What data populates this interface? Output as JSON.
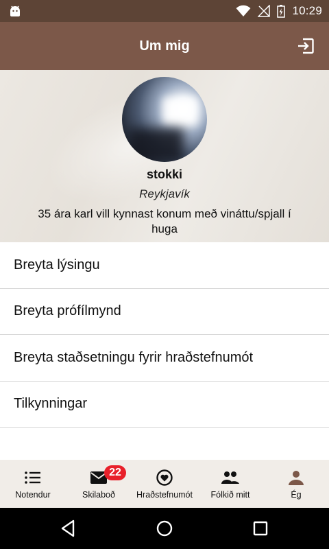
{
  "status_bar": {
    "time": "10:29",
    "icons": [
      "android-icon",
      "wifi-icon",
      "no-signal-icon",
      "battery-charging-icon"
    ]
  },
  "app_bar": {
    "title": "Um mig",
    "action_icon": "logout-icon"
  },
  "profile": {
    "name": "stokki",
    "location": "Reykjavík",
    "bio": "35 ára karl vill kynnast konum með vináttu/spjall í huga"
  },
  "menu": [
    {
      "label": "Breyta lýsingu"
    },
    {
      "label": "Breyta prófílmynd"
    },
    {
      "label": "Breyta staðsetningu fyrir hraðstefnumót"
    },
    {
      "label": "Tilkynningar"
    }
  ],
  "bottom_nav": [
    {
      "label": "Notendur",
      "icon": "list-icon"
    },
    {
      "label": "Skilaboð",
      "icon": "mail-icon",
      "badge": "22"
    },
    {
      "label": "Hraðstefnumót",
      "icon": "heart-circle-icon"
    },
    {
      "label": "Fólkið mitt",
      "icon": "people-icon"
    },
    {
      "label": "Ég",
      "icon": "person-icon",
      "active": true
    }
  ],
  "colors": {
    "status_bar": "#5d4436",
    "app_bar": "#7c5849",
    "accent_brown": "#7c5849",
    "badge": "#e8202a",
    "nav_bg": "#f1ede8"
  }
}
